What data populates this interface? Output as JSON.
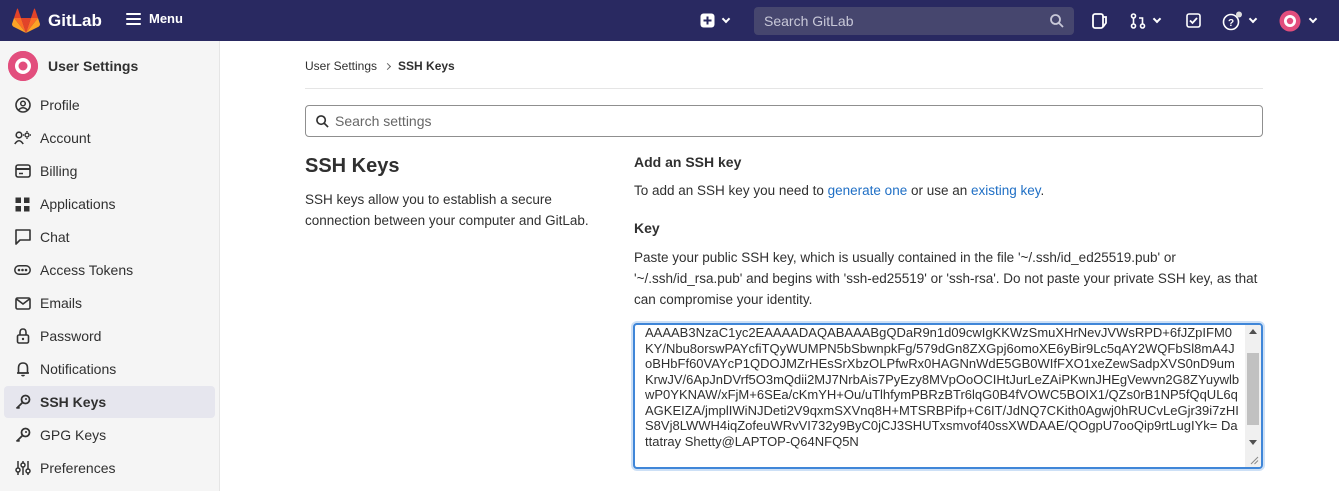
{
  "navbar": {
    "brand": "GitLab",
    "menu_label": "Menu",
    "search_placeholder": "Search GitLab",
    "icons": [
      "gitlab-logo-icon",
      "hamburger-icon",
      "plus-square-icon",
      "search-icon",
      "issues-icon",
      "merge-request-icon",
      "todo-check-icon",
      "help-icon",
      "avatar-icon"
    ]
  },
  "sidebar": {
    "title": "User Settings",
    "items": [
      {
        "label": "Profile",
        "icon": "profile-icon"
      },
      {
        "label": "Account",
        "icon": "account-icon"
      },
      {
        "label": "Billing",
        "icon": "billing-icon"
      },
      {
        "label": "Applications",
        "icon": "applications-icon"
      },
      {
        "label": "Chat",
        "icon": "chat-icon"
      },
      {
        "label": "Access Tokens",
        "icon": "token-icon"
      },
      {
        "label": "Emails",
        "icon": "email-icon"
      },
      {
        "label": "Password",
        "icon": "lock-icon"
      },
      {
        "label": "Notifications",
        "icon": "bell-icon"
      },
      {
        "label": "SSH Keys",
        "icon": "key-icon",
        "active": true
      },
      {
        "label": "GPG Keys",
        "icon": "key-icon"
      },
      {
        "label": "Preferences",
        "icon": "preferences-icon"
      }
    ]
  },
  "breadcrumb": {
    "parent": "User Settings",
    "current": "SSH Keys"
  },
  "settings_search": {
    "placeholder": "Search settings"
  },
  "section": {
    "title": "SSH Keys",
    "description": "SSH keys allow you to establish a secure connection between your computer and GitLab."
  },
  "add_key": {
    "title": "Add an SSH key",
    "desc_prefix": "To add an SSH key you need to ",
    "generate_link": "generate one",
    "desc_middle": " or use an ",
    "existing_link": "existing key",
    "desc_suffix": ".",
    "key_label": "Key",
    "key_help": "Paste your public SSH key, which is usually contained in the file '~/.ssh/id_ed25519.pub' or '~/.ssh/id_rsa.pub' and begins with 'ssh-ed25519' or 'ssh-rsa'. Do not paste your private SSH key, as that can compromise your identity.",
    "key_value": "AAAAB3NzaC1yc2EAAAADAQABAAABgQDaR9n1d09cwIgKKWzSmuXHrNevJVWsRPD+6fJZpIFM0KY/Nbu8orswPAYcfiTQyWUMPN5bSbwnpkFg/579dGn8ZXGpj6omoXE6yBir9Lc5qAY2WQFbSl8mA4JoBHbFf60VAYcP1QDOJMZrHEsSrXbzOLPfwRx0HAGNnWdE5GB0WIfFXO1xeZewSadpXVS0nD9umKrwJV/6ApJnDVrf5O3mQdii2MJ7NrbAis7PyEzy8MVpOoOCIHtJurLeZAiPKwnJHEgVewvn2G8ZYuywlbwP0YKNAW/xFjM+6SEa/cKmYH+Ou/uTlhfymPBRzBTr6lqG0B4fVOWC5BOIX1/QZs0rB1NP5fQqUL6qAGKEIZA/jmplIWiNJDeti2V9qxmSXVnq8H+MTSRBPifp+C6IT/JdNQ7CKith0Agwj0hRUCvLeGjr39i7zHIS8Vj8LWWH4iqZofeuWRvVI732y9ByC0jCJ3SHUTxsmvof40ssXWDAAE/QOgpU7ooQip9rtLugIYk= Dattatray Shetty@LAPTOP-Q64NFQ5N"
  },
  "colors": {
    "navbar_bg": "#292961",
    "link": "#1f6fc5",
    "focus_border": "#3f86d8",
    "sidebar_bg": "#f5f5f5",
    "active_item_bg": "#e6e6ee"
  }
}
